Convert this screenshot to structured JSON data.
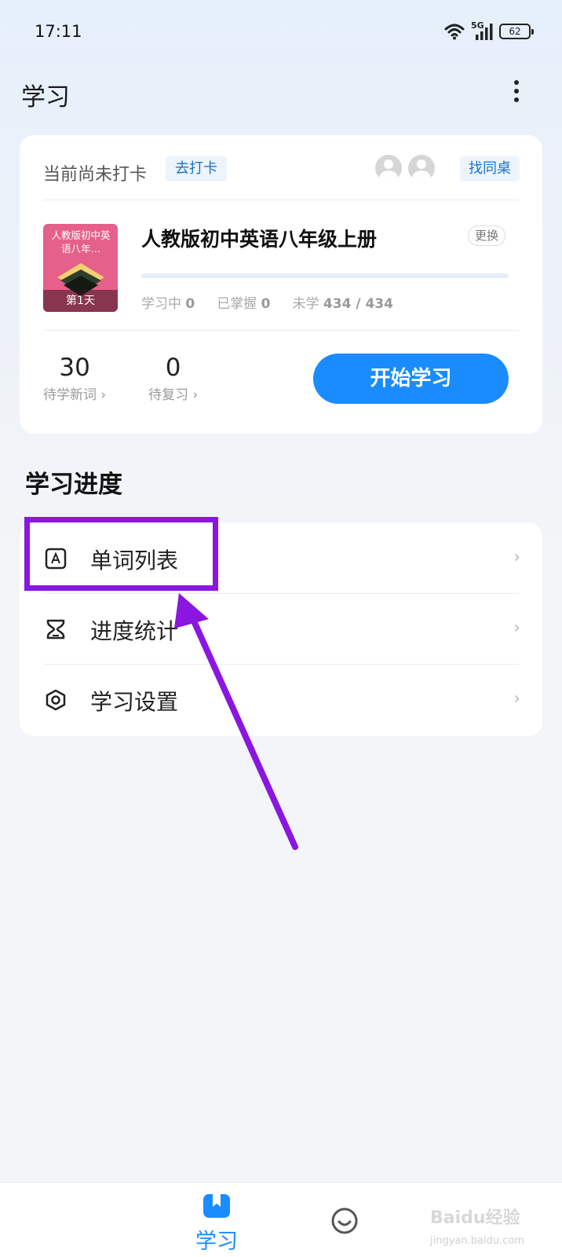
{
  "status_bar": {
    "time": "17:11",
    "network": "5G",
    "battery": "62"
  },
  "header": {
    "title": "学习"
  },
  "checkin": {
    "status_text": "当前尚未打卡",
    "checkin_label": "去打卡",
    "find_partner_label": "找同桌"
  },
  "book": {
    "cover_title": "人教版初中英语八年…",
    "cover_day": "第1天",
    "name": "人教版初中英语八年级上册",
    "change_label": "更换",
    "progress": 0,
    "learning_label": "学习中",
    "learning_value": "0",
    "mastered_label": "已掌握",
    "mastered_value": "0",
    "unlearned_label": "未学",
    "unlearned_value": "434 / 434"
  },
  "counts": {
    "new_words_value": "30",
    "new_words_label": "待学新词 ›",
    "review_value": "0",
    "review_label": "待复习 ›"
  },
  "start_button": {
    "label": "开始学习"
  },
  "progress_section": {
    "title": "学习进度",
    "items": [
      {
        "label": "单词列表",
        "icon": "word-list-icon"
      },
      {
        "label": "进度统计",
        "icon": "hourglass-icon"
      },
      {
        "label": "学习设置",
        "icon": "settings-hexagon-icon"
      }
    ]
  },
  "colors": {
    "accent": "#1a8cff",
    "annotation": "#8a16e0"
  },
  "bottom_nav": {
    "study_label": "学习"
  },
  "watermark": {
    "main": "Baidu经验",
    "sub": "jingyan.baidu.com"
  }
}
